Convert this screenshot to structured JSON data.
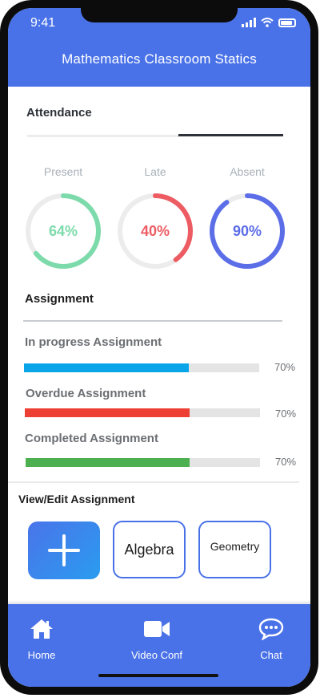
{
  "status_bar": {
    "time": "9:41"
  },
  "header": {
    "title": "Mathematics Classroom Statics"
  },
  "attendance": {
    "title": "Attendance",
    "items": [
      {
        "label": "Present",
        "value_text": "64%",
        "percent": 64,
        "color": "#7ddbab"
      },
      {
        "label": "Late",
        "value_text": "40%",
        "percent": 40,
        "color": "#ed5c63"
      },
      {
        "label": "Absent",
        "value_text": "90%",
        "percent": 90,
        "color": "#5c6de8"
      }
    ]
  },
  "assignment": {
    "title": "Assignment",
    "progress": [
      {
        "label": "In progress Assignment",
        "percent_text": "70%",
        "fill": 0.7,
        "color": "#0aa5e8"
      },
      {
        "label": "Overdue Assignment",
        "percent_text": "70%",
        "fill": 0.7,
        "color": "#ee3f35"
      },
      {
        "label": "Completed Assignment",
        "percent_text": "70%",
        "fill": 0.7,
        "color": "#4caf50"
      }
    ]
  },
  "view_edit": {
    "title": "View/Edit Assignment",
    "subjects": [
      "Algebra",
      "Geometry"
    ]
  },
  "bottom_nav": {
    "items": [
      {
        "label": "Home",
        "icon": "home-icon"
      },
      {
        "label": "Video Conf",
        "icon": "video-camera-icon"
      },
      {
        "label": "Chat",
        "icon": "chat-icon"
      }
    ]
  },
  "colors": {
    "primary": "#4a72e8",
    "track": "#ececec"
  }
}
